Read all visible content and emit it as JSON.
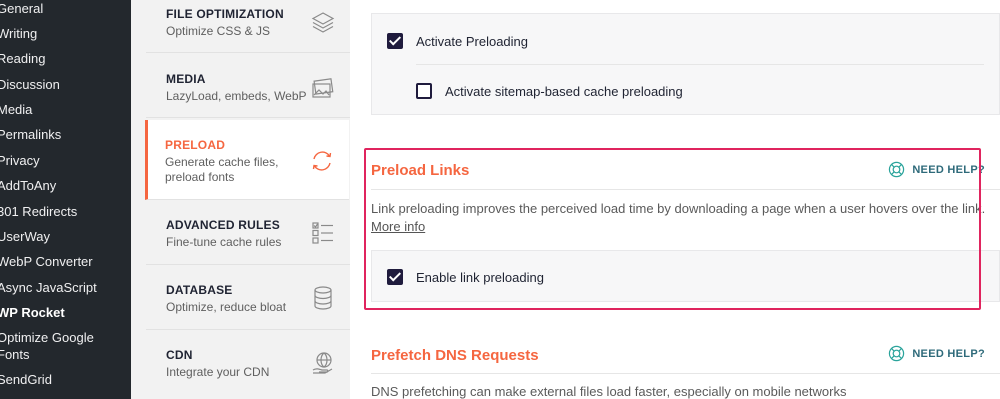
{
  "wp_menu": {
    "items": [
      {
        "label": "General"
      },
      {
        "label": "Writing"
      },
      {
        "label": "Reading"
      },
      {
        "label": "Discussion"
      },
      {
        "label": "Media"
      },
      {
        "label": "Permalinks"
      },
      {
        "label": "Privacy"
      },
      {
        "label": "AddToAny"
      },
      {
        "label": "301 Redirects"
      },
      {
        "label": "UserWay"
      },
      {
        "label": "WebP Converter"
      },
      {
        "label": "Async JavaScript"
      },
      {
        "label": "WP Rocket"
      },
      {
        "label": "Optimize Google"
      },
      {
        "label": "Fonts"
      },
      {
        "label": "SendGrid"
      }
    ]
  },
  "rocket_nav": {
    "items": [
      {
        "title": "FILE OPTIMIZATION",
        "sub1": "Optimize CSS & JS",
        "sub2": "",
        "icon": "layers-icon"
      },
      {
        "title": "MEDIA",
        "sub1": "LazyLoad, embeds, WebP",
        "sub2": "",
        "icon": "images-icon"
      },
      {
        "title": "PRELOAD",
        "sub1": "Generate cache files,",
        "sub2": "preload fonts",
        "icon": "refresh-icon"
      },
      {
        "title": "ADVANCED RULES",
        "sub1": "Fine-tune cache rules",
        "sub2": "",
        "icon": "checklist-icon"
      },
      {
        "title": "DATABASE",
        "sub1": "Optimize, reduce bloat",
        "sub2": "",
        "icon": "database-icon"
      },
      {
        "title": "CDN",
        "sub1": "Integrate your CDN",
        "sub2": "",
        "icon": "globe-hand-icon"
      }
    ],
    "active": "PRELOAD"
  },
  "preload_card": {
    "activate_preloading": {
      "label": "Activate Preloading",
      "checked": true
    },
    "sitemap_preloading": {
      "label": "Activate sitemap-based cache preloading",
      "checked": false
    }
  },
  "preload_links": {
    "title": "Preload Links",
    "need_help": "NEED HELP?",
    "description": "Link preloading improves the perceived load time by downloading a page when a user hovers over the link.",
    "more_info": "More info",
    "enable_link_preloading": {
      "label": "Enable link preloading",
      "checked": true
    }
  },
  "prefetch_dns": {
    "title": "Prefetch DNS Requests",
    "need_help": "NEED HELP?",
    "description": "DNS prefetching can make external files load faster, especially on mobile networks"
  },
  "colors": {
    "accent": "#f56640",
    "checkbox": "#1f1b3d",
    "highlight": "#e0245e",
    "help": "#2e6a7a"
  }
}
